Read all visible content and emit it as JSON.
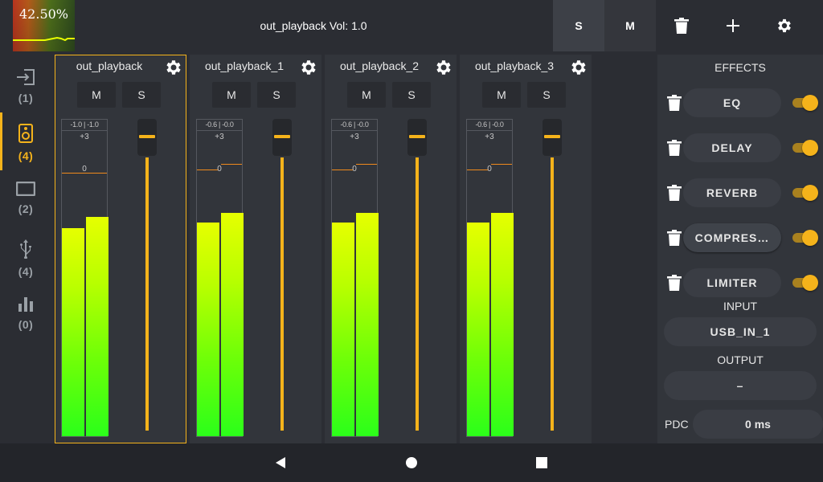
{
  "topbar": {
    "cpu_percent": "42.50%",
    "title": "out_playback Vol: 1.0",
    "solo_label": "S",
    "mute_label": "M",
    "icons": [
      "trash-icon",
      "plus-icon",
      "gear-icon"
    ]
  },
  "sidebar": {
    "items": [
      {
        "icon": "input-icon",
        "count": "(1)",
        "active": false
      },
      {
        "icon": "speaker-icon",
        "count": "(4)",
        "active": true
      },
      {
        "icon": "display-icon",
        "count": "(2)",
        "active": false
      },
      {
        "icon": "usb-icon",
        "count": "(4)",
        "active": false
      },
      {
        "icon": "bar-chart-icon",
        "count": "(0)",
        "active": false
      }
    ]
  },
  "channels": [
    {
      "name": "out_playback",
      "mute_label": "M",
      "solo_label": "S",
      "peak": "-1.0 | -1.0",
      "scale_top": "+3",
      "scale_zero": "0",
      "selected": true
    },
    {
      "name": "out_playback_1",
      "mute_label": "M",
      "solo_label": "S",
      "peak": "-0.6 | -0.0",
      "scale_top": "+3",
      "scale_zero": "0",
      "selected": false
    },
    {
      "name": "out_playback_2",
      "mute_label": "M",
      "solo_label": "S",
      "peak": "-0.6 | -0.0",
      "scale_top": "+3",
      "scale_zero": "0",
      "selected": false
    },
    {
      "name": "out_playback_3",
      "mute_label": "M",
      "solo_label": "S",
      "peak": "-0.6 | -0.0",
      "scale_top": "+3",
      "scale_zero": "0",
      "selected": false
    }
  ],
  "effects": {
    "title": "EFFECTS",
    "items": [
      {
        "label": "EQ",
        "enabled": true
      },
      {
        "label": "DELAY",
        "enabled": true
      },
      {
        "label": "REVERB",
        "enabled": true
      },
      {
        "label": "COMPRES…",
        "enabled": true
      },
      {
        "label": "LIMITER",
        "enabled": true
      }
    ],
    "input_title": "INPUT",
    "input_value": "USB_IN_1",
    "output_title": "OUTPUT",
    "output_value": "–",
    "pdc_label": "PDC",
    "pdc_value": "0 ms"
  },
  "colors": {
    "accent": "#f5b31b",
    "background": "#2b2d33",
    "strip": "#32353b"
  },
  "navbar": {
    "icons": [
      "back-icon",
      "home-icon",
      "recents-icon"
    ]
  }
}
